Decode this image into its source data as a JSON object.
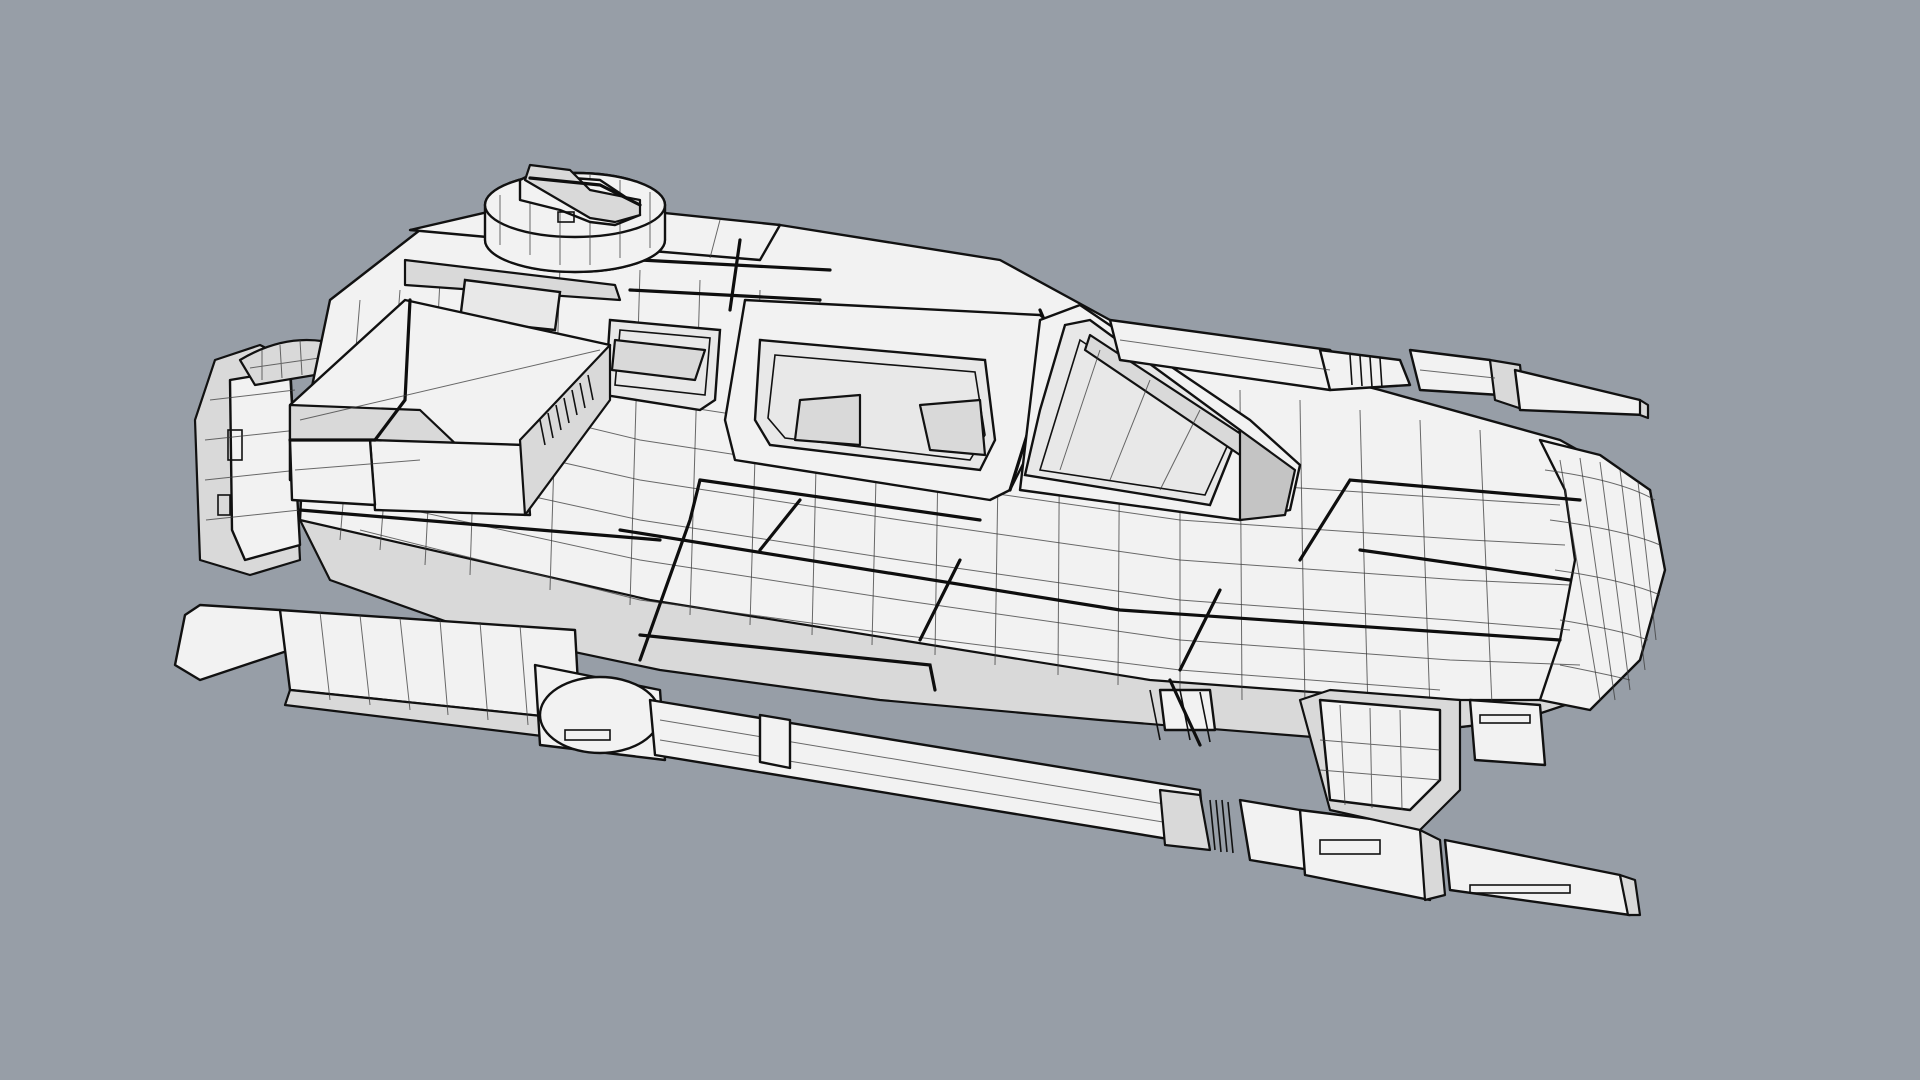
{
  "viewport": {
    "background": "#979ea7",
    "display_mode": "wireframe-shaded",
    "model": {
      "object": "spacecraft-hull",
      "surface_color": "#f2f2f2",
      "edge_color": "#111111",
      "isocurve_color": "#3a3a3a"
    }
  }
}
